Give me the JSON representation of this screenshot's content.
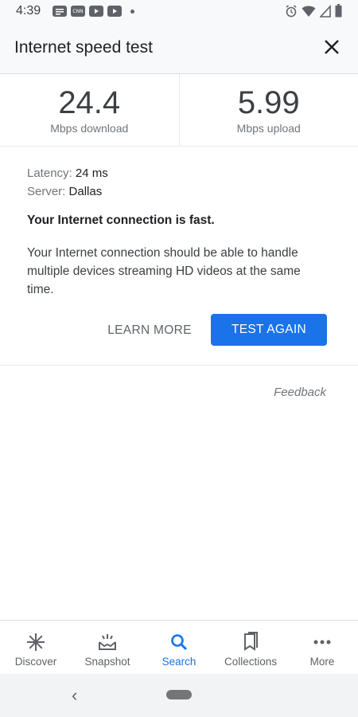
{
  "status_bar": {
    "time": "4:39",
    "left_icons": [
      "notes-icon",
      "cnn-icon",
      "youtube-icon",
      "youtube-icon",
      "dot-icon"
    ],
    "right_icons": [
      "alarm-icon",
      "wifi-icon",
      "signal-icon",
      "battery-icon"
    ],
    "cnn_label": "CNN"
  },
  "header": {
    "title": "Internet speed test",
    "close_icon": "close-icon"
  },
  "speed": {
    "download_value": "24.4",
    "download_label": "Mbps download",
    "upload_value": "5.99",
    "upload_label": "Mbps upload"
  },
  "details": {
    "latency_label": "Latency:",
    "latency_value": "24 ms",
    "server_label": "Server:",
    "server_value": "Dallas"
  },
  "result": {
    "verdict": "Your Internet connection is fast.",
    "description": "Your Internet connection should be able to handle multiple devices streaming HD videos at the same time."
  },
  "actions": {
    "learn_more": "LEARN MORE",
    "test_again": "TEST AGAIN"
  },
  "feedback": "Feedback",
  "bottom_nav": {
    "items": [
      {
        "label": "Discover",
        "icon": "asterisk-icon"
      },
      {
        "label": "Snapshot",
        "icon": "snapshot-icon"
      },
      {
        "label": "Search",
        "icon": "search-icon",
        "active": true
      },
      {
        "label": "Collections",
        "icon": "bookmark-icon"
      },
      {
        "label": "More",
        "icon": "more-icon"
      }
    ]
  },
  "colors": {
    "accent": "#1a73e8",
    "text_primary": "#202124",
    "text_secondary": "#70757a"
  }
}
